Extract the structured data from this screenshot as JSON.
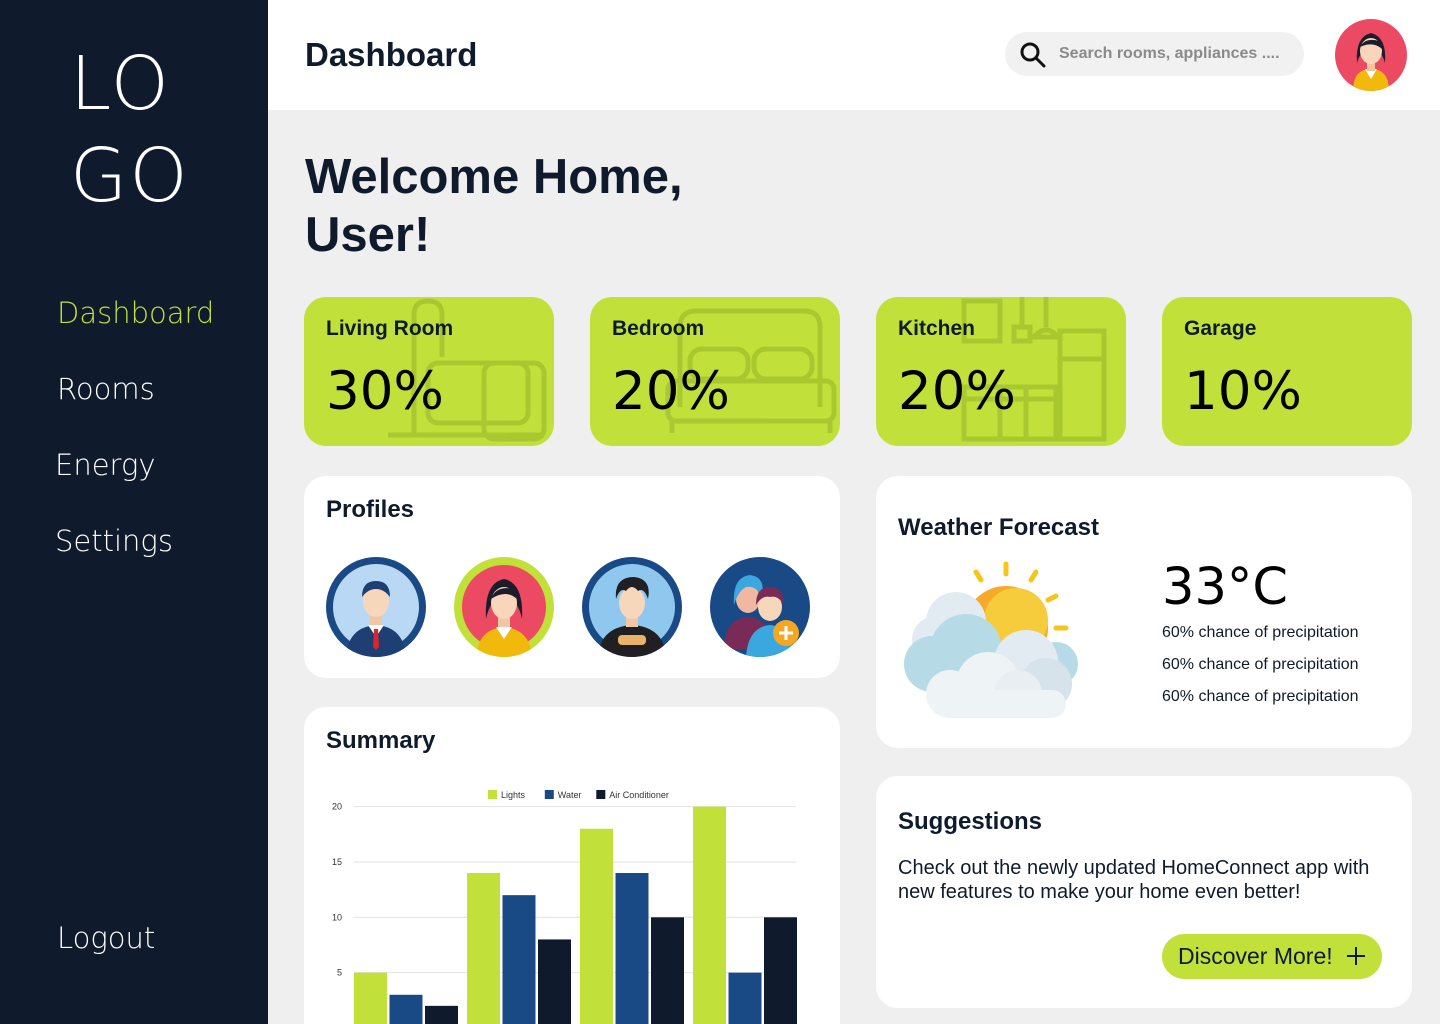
{
  "brand": {
    "logo": "LO\nGO"
  },
  "nav": {
    "dashboard": "Dashboard",
    "rooms": "Rooms",
    "energy": "Energy",
    "settings": "Settings",
    "logout": "Logout"
  },
  "header": {
    "title": "Dashboard",
    "search_placeholder": "Search rooms, appliances ...."
  },
  "welcome": "Welcome Home, User!",
  "rooms": [
    {
      "name": "Living Room",
      "value": "30%"
    },
    {
      "name": "Bedroom",
      "value": "20%"
    },
    {
      "name": "Kitchen",
      "value": "20%"
    },
    {
      "name": "Garage",
      "value": "10%"
    }
  ],
  "profiles": {
    "title": "Profiles"
  },
  "summary": {
    "title": "Summary"
  },
  "weather": {
    "title": "Weather Forecast",
    "temp": "33°C",
    "lines": [
      "60% chance of precipitation",
      "60% chance of precipitation",
      "60% chance of precipitation"
    ]
  },
  "suggestions": {
    "title": "Suggestions",
    "text": "Check out the newly updated HomeConnect app with new features to make your home even better!",
    "button": "Discover More!"
  },
  "colors": {
    "accent": "#c1e03a",
    "navy": "#0f1b2d",
    "blue": "#1a4a86"
  },
  "chart_data": {
    "type": "bar",
    "categories": [
      "",
      "",
      "",
      ""
    ],
    "series": [
      {
        "name": "Lights",
        "color": "#c1e03a",
        "values": [
          5,
          14,
          18,
          20
        ]
      },
      {
        "name": "Water",
        "color": "#1a4a86",
        "values": [
          3,
          12,
          14,
          5
        ]
      },
      {
        "name": "Air Conditioner",
        "color": "#0f1b2d",
        "values": [
          2,
          8,
          10,
          10
        ]
      }
    ],
    "yticks": [
      5,
      10,
      15,
      20
    ],
    "ylim": [
      0,
      20
    ],
    "legend": "top",
    "grid": true
  }
}
